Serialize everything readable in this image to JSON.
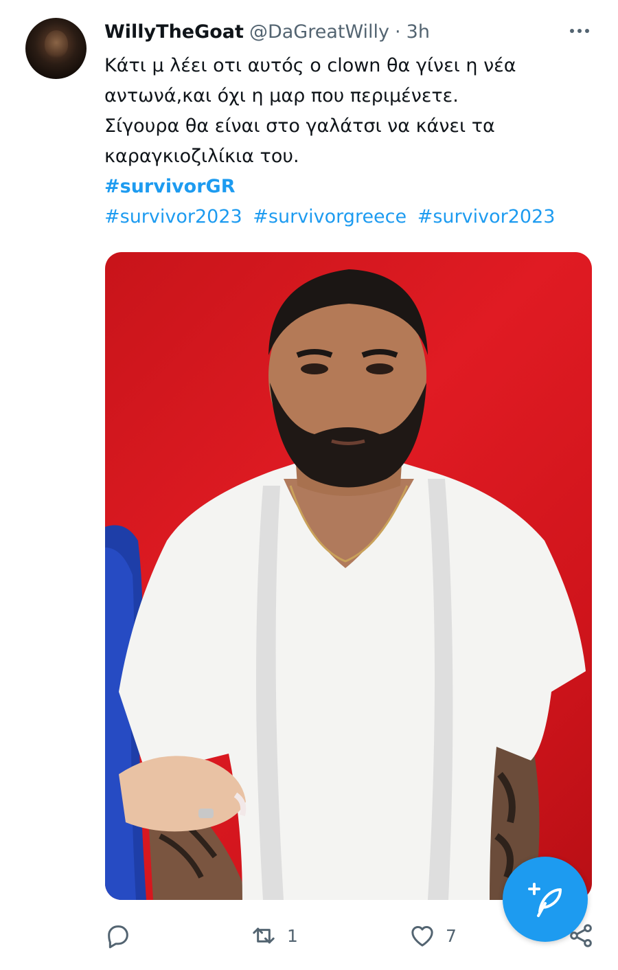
{
  "tweet": {
    "author_name": "WillyTheGoat",
    "author_handle": "@DaGreatWilly",
    "separator": "·",
    "time": "3h",
    "text_lines": [
      "Κάτι μ λέει οτι αυτός ο clown θα γίνει η νέα",
      "αντωνά,και όχι η μαρ που περιμένετε.",
      "Σίγουρα θα είναι στο γαλάτσι να κάνει τα",
      "καραγκιοζιλίκια του."
    ],
    "hashtags_line1": [
      "#survivorGR"
    ],
    "hashtags_line2": [
      "#survivor2023",
      "#survivorgreece",
      "#survivor2023"
    ],
    "actions": {
      "retweet_count": "1",
      "like_count": "7"
    }
  },
  "colors": {
    "accent": "#1d9bf0",
    "secondary_text": "#536471",
    "photo_background": "#e01b23"
  },
  "icons": {
    "more": "more-horizontal-icon",
    "reply": "reply-icon",
    "retweet": "retweet-icon",
    "like": "heart-icon",
    "share": "share-icon",
    "compose": "compose-tweet-icon"
  }
}
